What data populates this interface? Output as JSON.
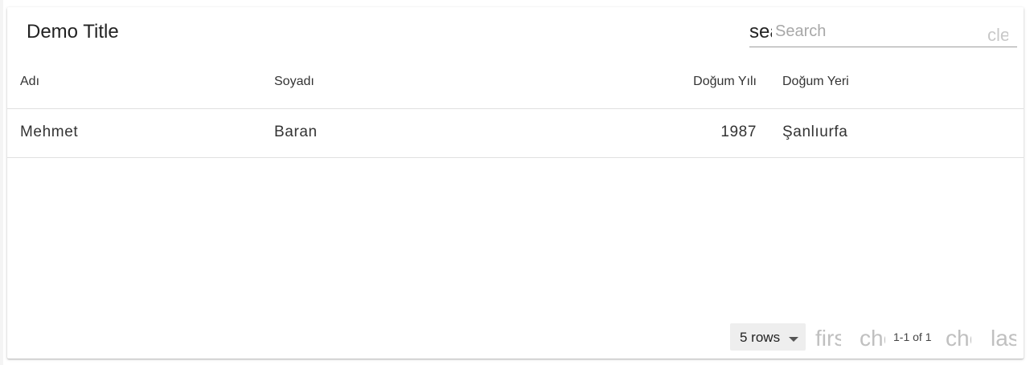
{
  "title": "Demo Title",
  "search": {
    "icon_text": "search",
    "icon": "search-icon",
    "placeholder": "Search",
    "value": "",
    "clear_text": "clear",
    "clear_icon": "clear-icon"
  },
  "table": {
    "columns": [
      "Adı",
      "Soyadı",
      "Doğum Yılı",
      "Doğum Yeri"
    ],
    "rows": [
      [
        "Mehmet",
        "Baran",
        "1987",
        "Şanlıurfa"
      ]
    ]
  },
  "pagination": {
    "rows_per_page": "5 rows",
    "range": "1-1 of 1",
    "first_text": "first_page",
    "prev_text": "chevron_left",
    "next_text": "chevron_right",
    "last_text": "last_page"
  }
}
